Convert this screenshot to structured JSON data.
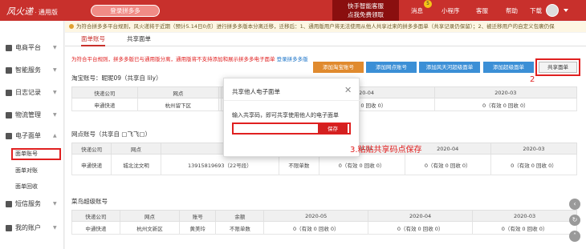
{
  "header": {
    "logo": "风火递",
    "edition": "· 通用版",
    "login_btn": "登录拼多多",
    "promo_line1": "快手智能客服",
    "promo_line2": "点我免费领取",
    "nav": [
      "消息",
      "小程序",
      "客服",
      "帮助",
      "下载"
    ],
    "badge": "5"
  },
  "sidebar": {
    "items": [
      {
        "label": "电商平台"
      },
      {
        "label": "智能服务"
      },
      {
        "label": "日志记录"
      },
      {
        "label": "物流管理"
      },
      {
        "label": "电子面单"
      },
      {
        "label": "短信服务"
      },
      {
        "label": "我的账户"
      }
    ],
    "sub": [
      "面单账号",
      "面单对账",
      "面单回收"
    ]
  },
  "annotations": {
    "a1": "1",
    "a2": "2",
    "a3": "3.粘贴共享码点保存"
  },
  "notice": "为符合拼多多平台规则，风火递将于近期（预计5.14日0点）进行拼多多版本分离迁移，迁移后：1、通用版用户将无法使用从他人共享过来的拼多多面单（共享记录仍保留）；2、被迁移用户的自定义包裹仍保",
  "tabs": [
    "面单账号",
    "共享面单"
  ],
  "warn": {
    "text": "为符合平台规则，拼多多版已与通用版分离，通用版将不支持添加和展示拼多多电子面单",
    "link": "登录拼多多版"
  },
  "buttons": {
    "add_taobao": "添加淘宝账号",
    "add_network": "添加网点账号",
    "add_ft": "添加风天河超级面单",
    "add_super": "添加超级面单",
    "share": "共享面单"
  },
  "sections": {
    "taobao": "淘宝账号：昵昵09（共享自 lily）",
    "network": "网点账号（共享自 ▢飞飞▢）",
    "cainiao": "菜鸟超级账号"
  },
  "modal": {
    "title": "共享他人电子面单",
    "label": "输入共享码，即可共享使用他人的电子面单",
    "save": "保存"
  },
  "table1": {
    "headers": [
      "快递公司",
      "网点",
      "",
      "",
      "2020-05",
      "2020-04",
      "2020-03"
    ],
    "rows": [
      [
        "申通快递",
        "杭州留下区",
        "",
        "",
        "",
        "0（有效 0 回收 0）",
        "0（有效 0 回收 0）"
      ]
    ]
  },
  "table2": {
    "headers": [
      "快递公司",
      "网点",
      "",
      "",
      "2020-05",
      "2020-04",
      "2020-03"
    ],
    "rows": [
      [
        "申通快递",
        "城北沈文明",
        "13915819693（22号段）",
        "不限单数",
        "0（有效 0 回收 0）",
        "0（有效 0 回收 0）",
        "0（有效 0 回收 0）"
      ]
    ]
  },
  "table3": {
    "headers": [
      "快递公司",
      "网点",
      "账号",
      "余额",
      "2020-05",
      "2020-04",
      "2020-03"
    ],
    "rows": [
      [
        "中通快递",
        "杭州文新区",
        "黄美玲",
        "不限单数",
        "0（有效 0 回收 0）",
        "0（有效 0 回收 0）",
        "0（有效 0 回收 0）"
      ]
    ]
  }
}
